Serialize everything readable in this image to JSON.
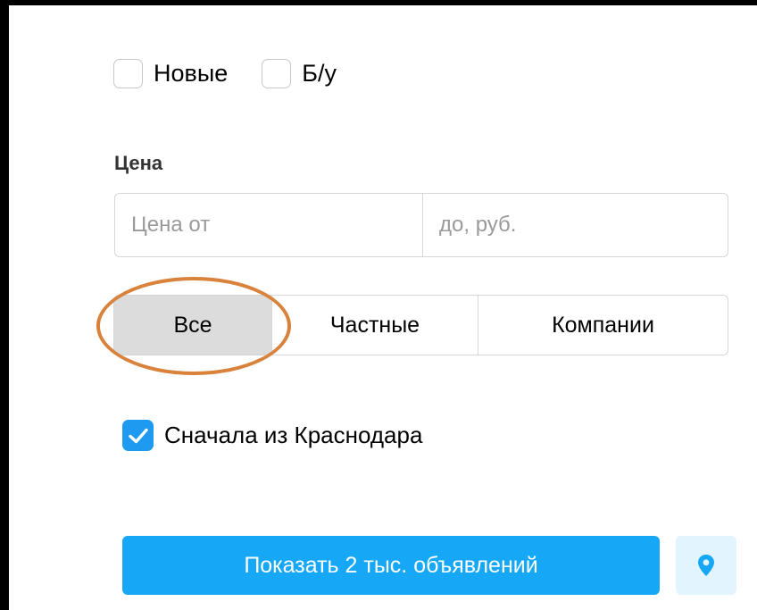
{
  "condition": {
    "options": [
      {
        "label": "Новые",
        "checked": false
      },
      {
        "label": "Б/у",
        "checked": false
      }
    ]
  },
  "price": {
    "title": "Цена",
    "from_placeholder": "Цена от",
    "to_placeholder": "до, руб.",
    "from_value": "",
    "to_value": ""
  },
  "seller": {
    "options": [
      "Все",
      "Частные",
      "Компании"
    ],
    "selected": "Все"
  },
  "local_first": {
    "label": "Сначала из Краснодара",
    "checked": true
  },
  "actions": {
    "show_label": "Показать 2 тыс. объявлений",
    "map_icon": "location-pin-icon"
  },
  "colors": {
    "accent": "#16a7f7",
    "checkbox_checked": "#1e9af0",
    "selected_segment": "#dcdcdc",
    "map_button_bg": "#e2f4fe",
    "highlight_ring": "#d9823c"
  }
}
